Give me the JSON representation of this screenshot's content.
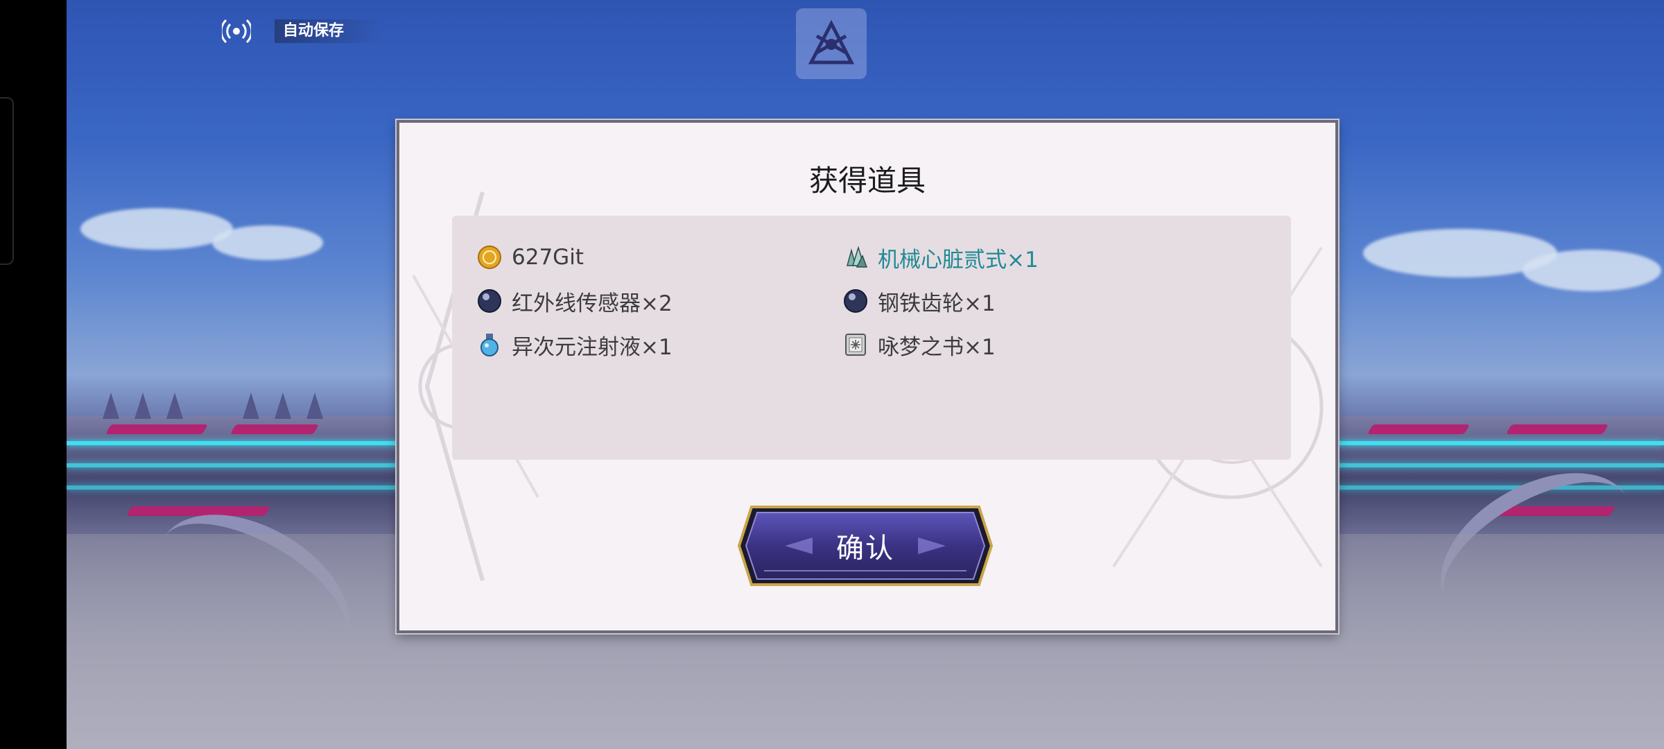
{
  "hud": {
    "autosave_label": "自动保存"
  },
  "dialog": {
    "title": "获得道具",
    "confirm_label": "确认",
    "items": [
      {
        "name": "627Git",
        "icon": "gold-coin-icon",
        "rare": false
      },
      {
        "name": "机械心脏贰式×1",
        "icon": "crystal-cluster-icon",
        "rare": true
      },
      {
        "name": "红外线传感器×2",
        "icon": "dark-orb-icon",
        "rare": false
      },
      {
        "name": "钢铁齿轮×1",
        "icon": "dark-orb-icon",
        "rare": false
      },
      {
        "name": "异次元注射液×1",
        "icon": "potion-flask-icon",
        "rare": false
      },
      {
        "name": "咏梦之书×1",
        "icon": "book-icon",
        "rare": false
      }
    ]
  },
  "colors": {
    "rare_text": "#1f8a93",
    "neon": "#3ee0f0",
    "accent_purple": "#4b3f9c",
    "gold_border": "#c9a64a"
  }
}
